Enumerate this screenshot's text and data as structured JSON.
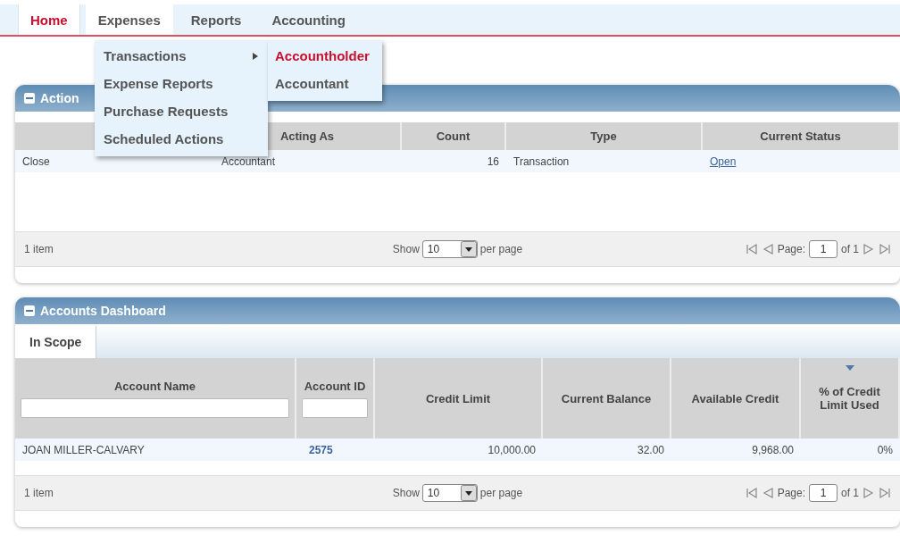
{
  "nav": [
    {
      "label": "Home",
      "selected": true,
      "open": false
    },
    {
      "label": "Expenses",
      "selected": false,
      "open": true
    },
    {
      "label": "Reports",
      "selected": false,
      "open": false
    },
    {
      "label": "Accounting",
      "selected": false,
      "open": false
    }
  ],
  "menu": {
    "items": [
      {
        "label": "Transactions",
        "submenu": true
      },
      {
        "label": "Expense Reports",
        "submenu": false
      },
      {
        "label": "Purchase Requests",
        "submenu": false
      },
      {
        "label": "Scheduled Actions",
        "submenu": false
      }
    ],
    "submenu": [
      {
        "label": "Accountholder",
        "selected": true
      },
      {
        "label": "Accountant",
        "selected": false
      }
    ]
  },
  "actions_panel": {
    "title": "Action",
    "columns": [
      {
        "kind": "text"
      },
      {
        "label": "Acting As",
        "kind": "text"
      },
      {
        "label": "Count",
        "kind": "number"
      },
      {
        "label": "Type",
        "kind": "text"
      },
      {
        "label": "Current Status",
        "kind": "link"
      }
    ],
    "rows": [
      [
        "Close",
        "Accountant",
        "16",
        "Transaction",
        "Open"
      ]
    ],
    "footer": {
      "count": "1 item",
      "show_label": "Show",
      "page_size": "10",
      "per_page": "per page",
      "page_label": "Page:",
      "page": "1",
      "of": "of 1"
    }
  },
  "accounts_panel": {
    "title": "Accounts Dashboard",
    "tabs": [
      {
        "label": "In Scope",
        "selected": true
      }
    ],
    "columns": [
      {
        "label": "Account Name",
        "kind": "text",
        "filter": true
      },
      {
        "label": "Account ID",
        "kind": "id",
        "filter": true
      },
      {
        "label": "Credit Limit",
        "kind": "number",
        "filter": false
      },
      {
        "label": "Current Balance",
        "kind": "number",
        "filter": false
      },
      {
        "label": "Available Credit",
        "kind": "number",
        "filter": false
      },
      {
        "label": "% of Credit Limit Used",
        "kind": "number",
        "filter": false,
        "sorted": true
      }
    ],
    "rows": [
      [
        "JOAN MILLER-CALVARY",
        "2575",
        "10,000.00",
        "32.00",
        "9,968.00",
        "0%"
      ]
    ],
    "footer": {
      "count": "1 item",
      "show_label": "Show",
      "page_size": "10",
      "per_page": "per page",
      "page_label": "Page:",
      "page": "1",
      "of": "of 1"
    }
  }
}
